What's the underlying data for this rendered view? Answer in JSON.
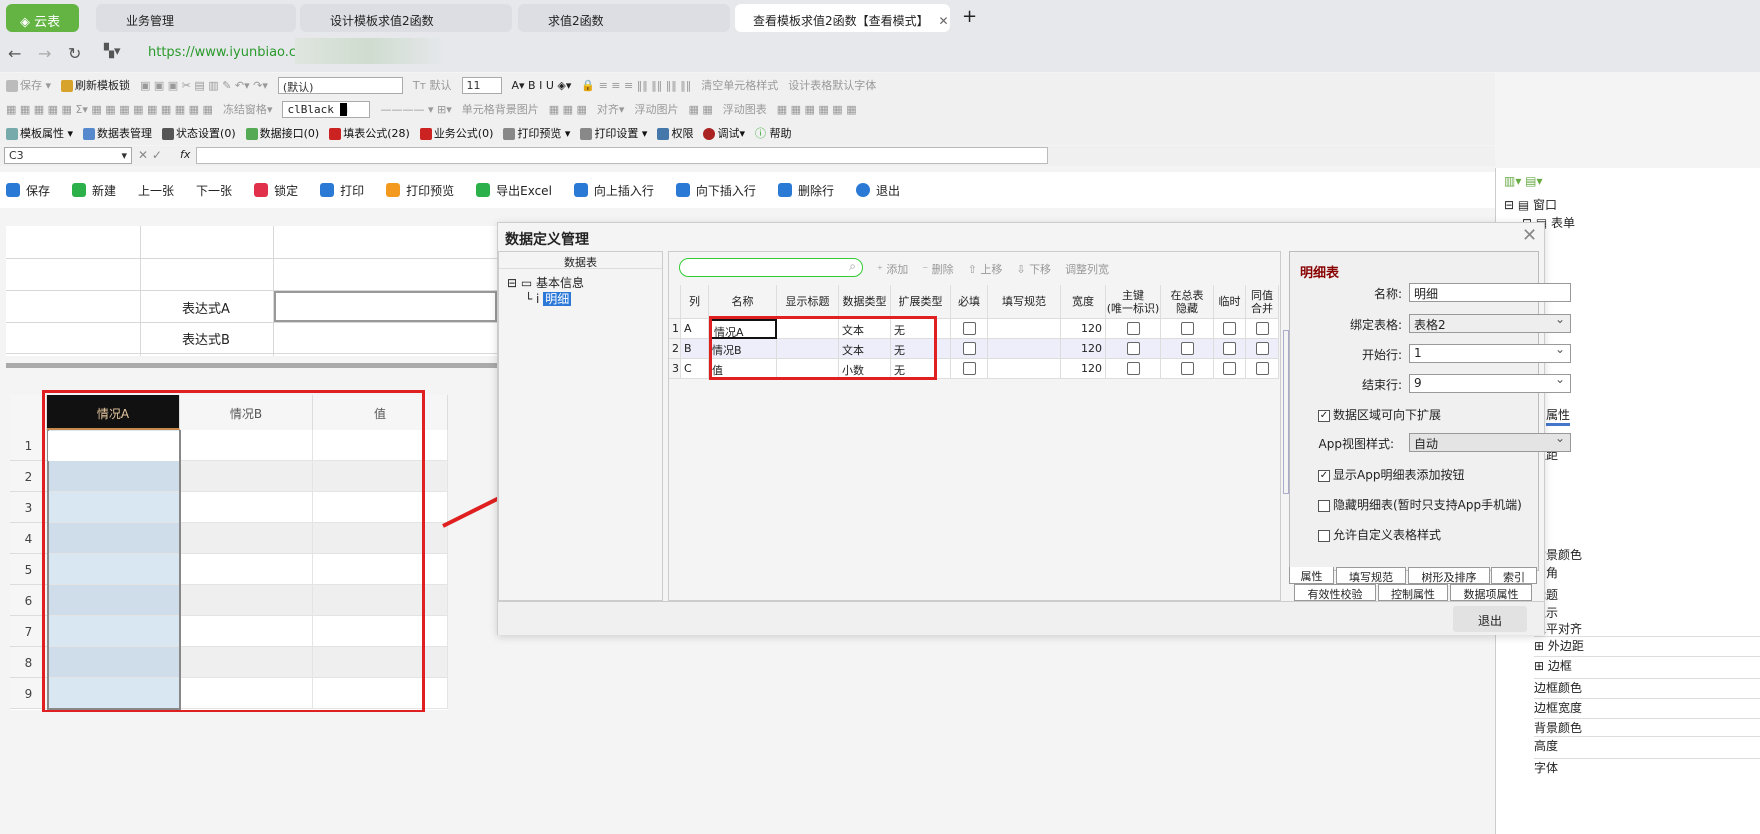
{
  "browser": {
    "brand": "云表",
    "tabs": [
      "业务管理",
      "设计模板求值2函数",
      "求值2函数",
      "查看模板求值2函数【查看模式】"
    ],
    "new_tab": "+",
    "url": "https://www.iyunbiao.cn/"
  },
  "toolbar1": [
    "保存",
    "刷新模板锁",
    "(默认)",
    "默认",
    "11",
    "清空单元格样式",
    "设计表格默认字体"
  ],
  "toolbar2": [
    "冻结窗格",
    "clBlack",
    "单元格背景图片",
    "对齐",
    "浮动图片",
    "浮动图表"
  ],
  "toolbar3": [
    "模板属性",
    "数据表管理",
    "状态设置(0)",
    "数据接口(0)",
    "填表公式(28)",
    "业务公式(0)",
    "打印预览",
    "打印设置",
    "权限",
    "调试",
    "帮助"
  ],
  "formula": {
    "cell_ref": "C3",
    "fx": "fx"
  },
  "actions": [
    "保存",
    "新建",
    "上一张",
    "下一张",
    "锁定",
    "打印",
    "打印预览",
    "导出Excel",
    "向上插入行",
    "向下插入行",
    "删除行",
    "退出"
  ],
  "upper_sheet": {
    "labels": [
      "表达式A",
      "表达式B"
    ]
  },
  "lower_sheet": {
    "headers": [
      "情况A",
      "情况B",
      "值"
    ],
    "rows": [
      "1",
      "2",
      "3",
      "4",
      "5",
      "6",
      "7",
      "8",
      "9"
    ]
  },
  "dialog": {
    "title": "数据定义管理",
    "left": {
      "header": "数据表",
      "tree_root": "基本信息",
      "tree_child": "明细"
    },
    "grid_toolbar": [
      "添加",
      "删除",
      "上移",
      "下移",
      "调整列宽"
    ],
    "columns": [
      "",
      "列",
      "名称",
      "显示标题",
      "数据类型",
      "扩展类型",
      "必填",
      "填写规范",
      "宽度",
      "主键\n(唯一标识)",
      "在总表\n隐藏",
      "临时",
      "同值\n合并"
    ],
    "rows": [
      {
        "n": "1",
        "col": "A",
        "name": "情况A",
        "type": "文本",
        "ext": "无",
        "width": "120"
      },
      {
        "n": "2",
        "col": "B",
        "name": "情况B",
        "type": "文本",
        "ext": "无",
        "width": "120"
      },
      {
        "n": "3",
        "col": "C",
        "name": "值",
        "type": "小数",
        "ext": "无",
        "width": "120"
      }
    ],
    "props": {
      "title": "明细表",
      "name_label": "名称:",
      "name": "明细",
      "bind_label": "绑定表格:",
      "bind": "表格2",
      "start_label": "开始行:",
      "start": "1",
      "end_label": "结束行:",
      "end": "9",
      "expand": "数据区域可向下扩展",
      "app_view_label": "App视图样式:",
      "app_view": "自动",
      "show_add": "显示App明细表添加按钮",
      "hide": "隐藏明细表(暂时只支持App手机端)",
      "custom": "允许自定义表格样式"
    },
    "tabs_row1": [
      "属性",
      "填写规范",
      "树形及排序",
      "索引"
    ],
    "tabs_row2": [
      "有效性校验",
      "控制属性",
      "数据项属性"
    ],
    "exit": "退出"
  },
  "right_sidebar": {
    "root": "窗口",
    "child": "表单",
    "items": [
      "属性",
      "边距",
      "背景颜色",
      "圆角",
      "标题",
      "显示",
      "水平对齐",
      "外边距",
      "边框",
      "边框颜色",
      "边框宽度",
      "背景颜色",
      "高度",
      "字体"
    ]
  }
}
